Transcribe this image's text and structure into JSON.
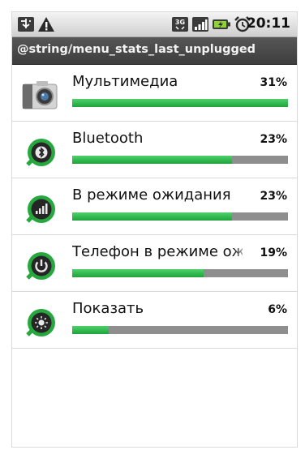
{
  "status_bar": {
    "icons": [
      "usb-debug-icon",
      "warning-icon",
      "3g-icon",
      "signal-icon",
      "battery-icon",
      "alarm-icon"
    ],
    "time": "20:11"
  },
  "title": "@string/menu_stats_last_unplugged",
  "items": [
    {
      "label": "Мультимедиа",
      "percent": "31%",
      "fraction": 1.0,
      "icon": "camera-icon"
    },
    {
      "label": "Bluetooth",
      "percent": "23%",
      "fraction": 0.74,
      "icon": "bluetooth-icon"
    },
    {
      "label": "В режиме ожидания",
      "percent": "23%",
      "fraction": 0.74,
      "icon": "signal-standby-icon"
    },
    {
      "label": "Телефон в режиме ожидания",
      "percent": "19%",
      "fraction": 0.61,
      "icon": "power-icon"
    },
    {
      "label": "Показать",
      "percent": "6%",
      "fraction": 0.17,
      "icon": "display-brightness-icon"
    }
  ],
  "colors": {
    "bar_fill": "#2db24a",
    "bar_track": "#8e8e8e",
    "title_bg": "#474747",
    "icon_ring": "#27a83f"
  }
}
